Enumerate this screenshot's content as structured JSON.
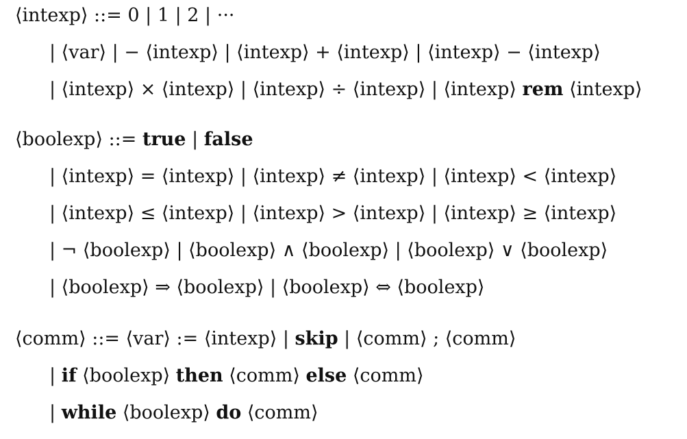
{
  "grammar": {
    "intexp": {
      "l1": {
        "a": "⟨intexp⟩ ::= 0 | 1 | 2 | ···"
      },
      "l2": {
        "a": "| ⟨var⟩ |  − ⟨intexp⟩ | ⟨intexp⟩ + ⟨intexp⟩ | ⟨intexp⟩ − ⟨intexp⟩"
      },
      "l3": {
        "a": "| ⟨intexp⟩ × ⟨intexp⟩ | ⟨intexp⟩ ÷ ⟨intexp⟩ | ⟨intexp⟩ ",
        "kw": "rem",
        "b": " ⟨intexp⟩"
      }
    },
    "boolexp": {
      "l1": {
        "a": "⟨boolexp⟩ ::= ",
        "kw1": "true",
        "mid": " | ",
        "kw2": "false"
      },
      "l2": {
        "a": "| ⟨intexp⟩ = ⟨intexp⟩ | ⟨intexp⟩ ≠ ⟨intexp⟩ | ⟨intexp⟩ < ⟨intexp⟩"
      },
      "l3": {
        "a": "| ⟨intexp⟩ ≤ ⟨intexp⟩ | ⟨intexp⟩ > ⟨intexp⟩ | ⟨intexp⟩ ≥ ⟨intexp⟩"
      },
      "l4": {
        "a": "|  ¬ ⟨boolexp⟩ | ⟨boolexp⟩ ∧ ⟨boolexp⟩ | ⟨boolexp⟩ ∨ ⟨boolexp⟩"
      },
      "l5": {
        "a": "| ⟨boolexp⟩ ⇒ ⟨boolexp⟩ | ⟨boolexp⟩ ⇔ ⟨boolexp⟩"
      }
    },
    "comm": {
      "l1": {
        "a": "⟨comm⟩ ::= ⟨var⟩ := ⟨intexp⟩ | ",
        "kw": "skip",
        "b": " | ⟨comm⟩ ; ⟨comm⟩"
      },
      "l2": {
        "a": "| ",
        "kw1": "if",
        "b": " ⟨boolexp⟩ ",
        "kw2": "then",
        "c": " ⟨comm⟩ ",
        "kw3": "else",
        "d": " ⟨comm⟩"
      },
      "l3": {
        "a": "| ",
        "kw1": "while",
        "b": " ⟨boolexp⟩ ",
        "kw2": "do",
        "c": " ⟨comm⟩"
      }
    }
  }
}
